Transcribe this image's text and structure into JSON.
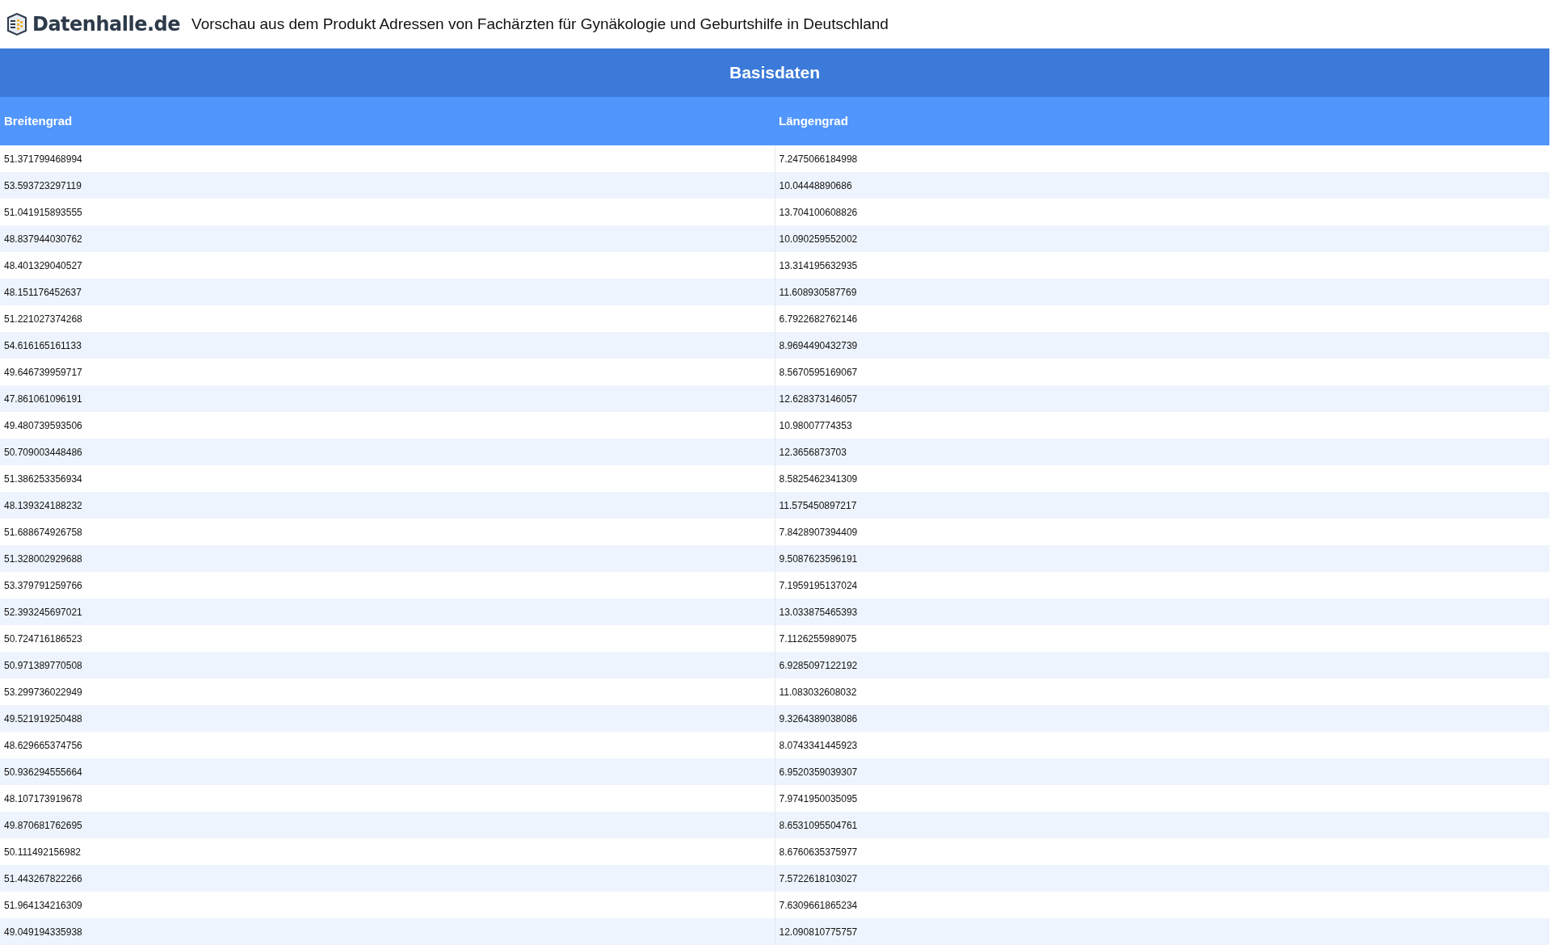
{
  "header": {
    "logo_text": "Datenhalle.de",
    "title": "Vorschau aus dem Produkt Adressen von Fachärzten für Gynäkologie und Geburtshilfe in Deutschland"
  },
  "table": {
    "group_title": "Basisdaten",
    "columns": [
      "Breitengrad",
      "Längengrad"
    ],
    "rows": [
      [
        "51.371799468994",
        "7.2475066184998"
      ],
      [
        "53.593723297119",
        "10.04448890686"
      ],
      [
        "51.041915893555",
        "13.704100608826"
      ],
      [
        "48.837944030762",
        "10.090259552002"
      ],
      [
        "48.401329040527",
        "13.314195632935"
      ],
      [
        "48.151176452637",
        "11.608930587769"
      ],
      [
        "51.221027374268",
        "6.7922682762146"
      ],
      [
        "54.616165161133",
        "8.9694490432739"
      ],
      [
        "49.646739959717",
        "8.5670595169067"
      ],
      [
        "47.861061096191",
        "12.628373146057"
      ],
      [
        "49.480739593506",
        "10.98007774353"
      ],
      [
        "50.709003448486",
        "12.3656873703"
      ],
      [
        "51.386253356934",
        "8.5825462341309"
      ],
      [
        "48.139324188232",
        "11.575450897217"
      ],
      [
        "51.688674926758",
        "7.8428907394409"
      ],
      [
        "51.328002929688",
        "9.5087623596191"
      ],
      [
        "53.379791259766",
        "7.1959195137024"
      ],
      [
        "52.393245697021",
        "13.033875465393"
      ],
      [
        "50.724716186523",
        "7.1126255989075"
      ],
      [
        "50.971389770508",
        "6.9285097122192"
      ],
      [
        "53.299736022949",
        "11.083032608032"
      ],
      [
        "49.521919250488",
        "9.3264389038086"
      ],
      [
        "48.629665374756",
        "8.0743341445923"
      ],
      [
        "50.936294555664",
        "6.9520359039307"
      ],
      [
        "48.107173919678",
        "7.9741950035095"
      ],
      [
        "49.870681762695",
        "8.6531095504761"
      ],
      [
        "50.111492156982",
        "8.6760635375977"
      ],
      [
        "51.443267822266",
        "7.5722618103027"
      ],
      [
        "51.964134216309",
        "7.6309661865234"
      ],
      [
        "49.049194335938",
        "12.090810775757"
      ]
    ]
  }
}
